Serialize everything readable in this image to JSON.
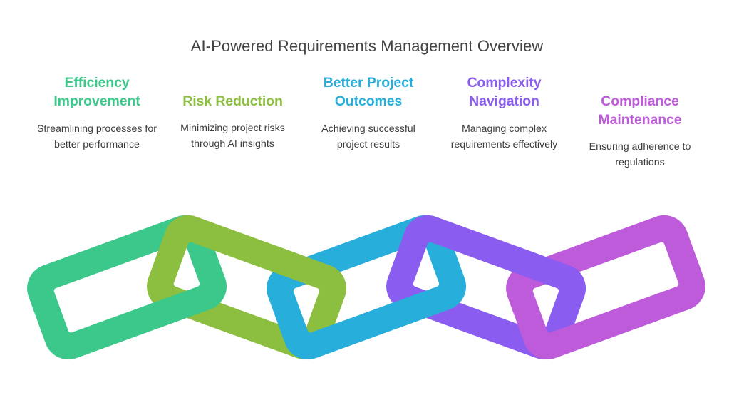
{
  "title": "AI-Powered Requirements Management Overview",
  "background_color": "#ffffff",
  "title_color": "#434343",
  "body_text_color": "#3c3c3c",
  "columns": [
    {
      "heading": "Efficiency Improvement",
      "description": "Streamlining processes for better performance",
      "color": "#3cc88a"
    },
    {
      "heading": "Risk Reduction",
      "description": "Minimizing project risks through AI insights",
      "color": "#8cbe3f"
    },
    {
      "heading": "Better Project Outcomes",
      "description": "Achieving successful project results",
      "color": "#27aedb"
    },
    {
      "heading": "Complexity Navigation",
      "description": "Managing complex requirements effectively",
      "color": "#8b5cf0"
    },
    {
      "heading": "Compliance Maintenance",
      "description": "Ensuring adherence to regulations",
      "color": "#bd5bdb"
    }
  ],
  "chain": {
    "link_count": 5,
    "link_colors": [
      "#3cc88a",
      "#8cbe3f",
      "#27aedb",
      "#8b5cf0",
      "#bd5bdb"
    ],
    "tilt_degrees": [
      -20,
      20,
      -20,
      20,
      -20
    ]
  }
}
